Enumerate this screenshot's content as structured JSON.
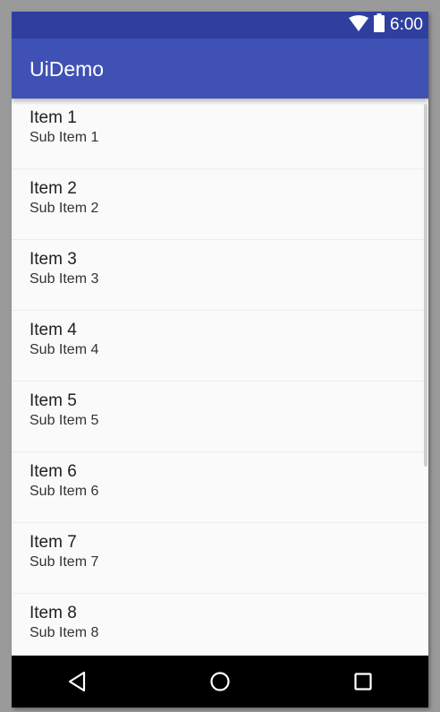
{
  "status_bar": {
    "time": "6:00",
    "icons": [
      "wifi-icon",
      "battery-icon"
    ],
    "color": "#303f9f"
  },
  "app_bar": {
    "title": "UiDemo",
    "color": "#3f51b5"
  },
  "list": {
    "items": [
      {
        "title": "Item 1",
        "subtitle": "Sub Item 1"
      },
      {
        "title": "Item 2",
        "subtitle": "Sub Item 2"
      },
      {
        "title": "Item 3",
        "subtitle": "Sub Item 3"
      },
      {
        "title": "Item 4",
        "subtitle": "Sub Item 4"
      },
      {
        "title": "Item 5",
        "subtitle": "Sub Item 5"
      },
      {
        "title": "Item 6",
        "subtitle": "Sub Item 6"
      },
      {
        "title": "Item 7",
        "subtitle": "Sub Item 7"
      },
      {
        "title": "Item 8",
        "subtitle": "Sub Item 8"
      }
    ]
  },
  "nav_bar": {
    "buttons": [
      "back-icon",
      "home-icon",
      "recents-icon"
    ]
  }
}
